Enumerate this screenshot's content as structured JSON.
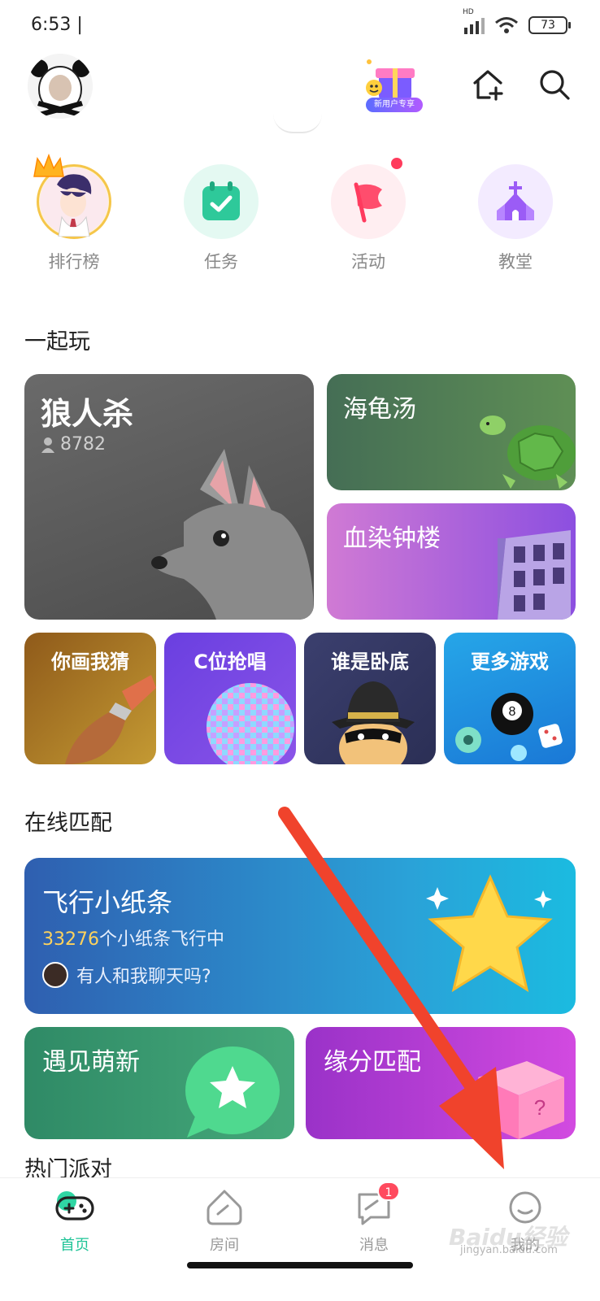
{
  "status_bar": {
    "time": "6:53 |",
    "signal_label": "HD",
    "battery": "73"
  },
  "header": {
    "promo_label": "新用户专享"
  },
  "quick_actions": [
    {
      "label": "排行榜",
      "icon": "leaderboard-icon"
    },
    {
      "label": "任务",
      "icon": "task-calendar-icon"
    },
    {
      "label": "活动",
      "icon": "flag-icon"
    },
    {
      "label": "教堂",
      "icon": "church-icon"
    }
  ],
  "play_together": {
    "title": "一起玩",
    "werewolf": {
      "title": "狼人杀",
      "players": "8782"
    },
    "turtle_soup": {
      "title": "海龟汤"
    },
    "bloody_tower": {
      "title": "血染钟楼"
    },
    "small_games": [
      {
        "title": "你画我猜"
      },
      {
        "title": "C位抢唱"
      },
      {
        "title": "谁是卧底"
      },
      {
        "title": "更多游戏"
      }
    ]
  },
  "online_match": {
    "title": "在线匹配",
    "paper_plane": {
      "title": "飞行小纸条",
      "count": "33276",
      "count_suffix": "个小纸条飞行中",
      "chat_prompt": "有人和我聊天吗?"
    },
    "meet_new": {
      "title": "遇见萌新"
    },
    "fate_match": {
      "title": "缘分匹配"
    }
  },
  "hot_party": {
    "title": "热门派对"
  },
  "bottom_nav": [
    {
      "label": "首页",
      "icon": "gamepad-icon",
      "active": true
    },
    {
      "label": "房间",
      "icon": "room-icon"
    },
    {
      "label": "消息",
      "icon": "message-icon",
      "badge": "1"
    },
    {
      "label": "我的",
      "icon": "smiley-profile-icon"
    }
  ],
  "watermark": {
    "brand": "Baidu经验",
    "url": "jingyan.baidu.com"
  },
  "colors": {
    "accent": "#1fc497",
    "werewolf_bg": "#5a5a5a",
    "turtle_bg": "#3f6b55",
    "tower_bg": "#c86bd6",
    "fly_bg": "#2a8fd8",
    "meet_bg": "#2f9a6c",
    "fate_bg": "#b23cd8",
    "arrow": "#f0432c"
  }
}
